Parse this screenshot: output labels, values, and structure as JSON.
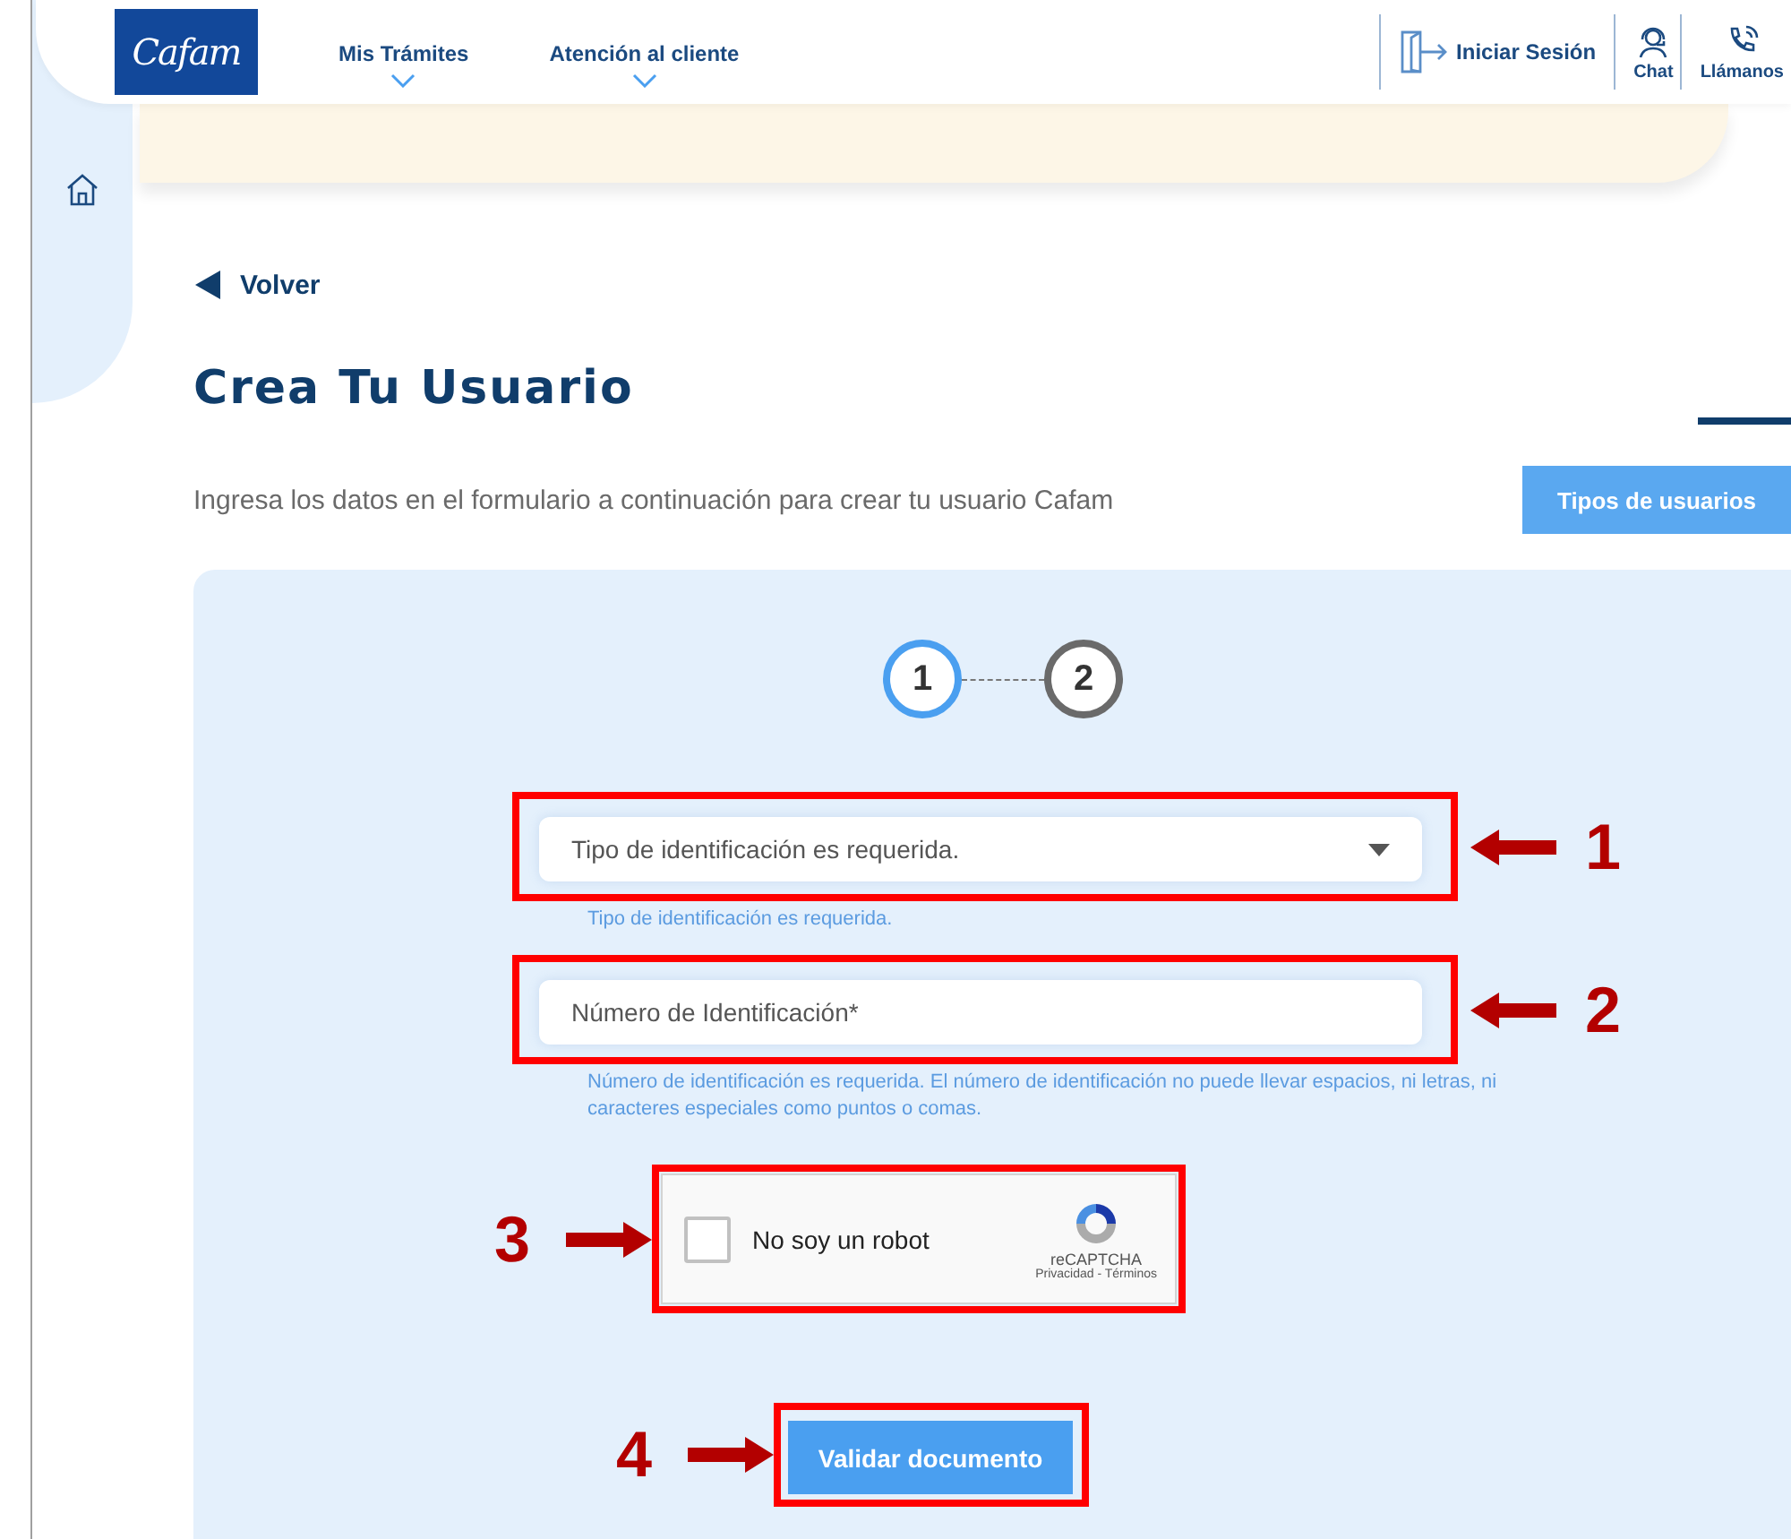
{
  "header": {
    "logo": "Cafam",
    "nav": [
      {
        "label": "Mis Trámites"
      },
      {
        "label": "Atención al cliente"
      }
    ],
    "actions": [
      {
        "kind": "login",
        "label": "Iniciar Sesión"
      },
      {
        "kind": "chat",
        "label": "Chat"
      },
      {
        "kind": "call",
        "label": "Llámanos"
      }
    ]
  },
  "back_link": "Volver",
  "title": "Crea Tu Usuario",
  "intro": "Ingresa los datos en el formulario a continuación para crear tu usuario Cafam",
  "user_types_button": "Tipos de usuarios",
  "steps": [
    {
      "label": "1",
      "selected": true
    },
    {
      "label": "2",
      "selected": false
    }
  ],
  "form": {
    "fields": [
      {
        "kind": "select",
        "value": "Tipo de identificación es requerida.",
        "error": "Tipo de identificación es requerida.",
        "annotation": {
          "number": "1",
          "kind": "left"
        }
      },
      {
        "kind": "text",
        "placeholder": "Número de Identificación*",
        "error": "Número de identificación es requerida. El número de identificación no puede llevar espacios, ni letras, ni caracteres especiales como puntos o comas.",
        "annotation": {
          "number": "2",
          "kind": "left"
        }
      },
      {
        "kind": "captcha",
        "label": "No soy un robot",
        "checked": false,
        "brand": "reCAPTCHA",
        "links": "Privacidad - Términos",
        "annotation": {
          "number": "3",
          "kind": "right"
        }
      },
      {
        "kind": "submit",
        "label": "Validar documento",
        "annotation": {
          "number": "4",
          "kind": "right"
        }
      }
    ]
  }
}
